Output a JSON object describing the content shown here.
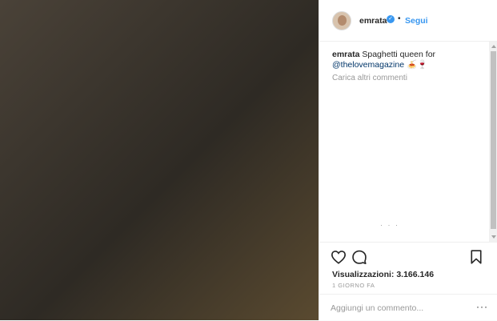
{
  "post": {
    "username": "emrata",
    "follow_label": "Segui",
    "dot": "•",
    "caption": {
      "username": "emrata",
      "text": "Spaghetti queen for",
      "mention": "@thelovemagazine",
      "emoji": "🍝🍷"
    },
    "load_more_label": "Carica altri commenti",
    "loading_indicator": "· · ·",
    "views_label": "Visualizzazioni: 3.166.146",
    "time_label": "1 GIORNO FA",
    "comment_placeholder": "Aggiungi un commento...",
    "more_label": "···"
  },
  "icons": {
    "verified": "verified-badge-icon",
    "like": "heart-icon",
    "comment": "comment-bubble-icon",
    "save": "bookmark-icon",
    "more": "more-options-icon"
  },
  "colors": {
    "link": "#3897f0",
    "mention": "#003569",
    "muted": "#999999",
    "text": "#262626"
  }
}
